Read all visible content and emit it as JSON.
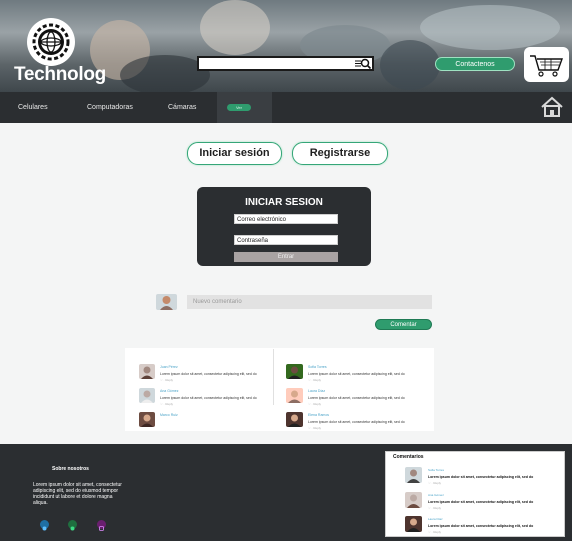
{
  "brand": {
    "name": "Technolog"
  },
  "header": {
    "search": {
      "value": "",
      "placeholder": ""
    },
    "contact_label": "Contactenos"
  },
  "nav": {
    "items": [
      "Celulares",
      "Computadoras",
      "Cámaras"
    ],
    "active_pill": "Ver"
  },
  "auth": {
    "login_label": "Iniciar sesión",
    "register_label": "Registrarse"
  },
  "login_card": {
    "title": "INICIAR SESION",
    "email_placeholder": "Correo electrónico",
    "password_placeholder": "Contraseña",
    "submit_label": "Entrar"
  },
  "composer": {
    "placeholder": "Nuevo comentario",
    "submit_label": "Comentar"
  },
  "comments": [
    {
      "name": "Juan Pérez",
      "text": "Lorem ipsum dolor sit amet, consectetur adipiscing elit, sed do",
      "meta": "♡  ·  Reply"
    },
    {
      "name": "Ana Gómez",
      "text": "Lorem ipsum dolor sit amet, consectetur adipiscing elit, sed do",
      "meta": "♡  ·  Reply"
    },
    {
      "name": "Marco Ruiz",
      "text": "Lorem ipsum dolor sit amet, consectetur adipiscing elit, sed do",
      "meta": "♡  ·  Reply"
    },
    {
      "name": "Sofia Torres",
      "text": "Lorem ipsum dolor sit amet, consectetur adipiscing elit, sed do",
      "meta": "♡  ·  Reply"
    },
    {
      "name": "Laura Díaz",
      "text": "Lorem ipsum dolor sit amet, consectetur adipiscing elit, sed do",
      "meta": "♡  ·  Reply"
    },
    {
      "name": "Elena Ramos",
      "text": "Lorem ipsum dolor sit amet, consectetur adipiscing elit, sed do",
      "meta": "♡  ·  Reply"
    }
  ],
  "footer": {
    "about_title": "Sobre nosotros",
    "about_text": "Lorem ipsum dolor sit amet, consectetur adipiscing elit, sed do eiusmod tempor incididunt ut labore et dolore magna aliqua.",
    "comments_title": "Comentarios",
    "comments": [
      {
        "name": "Sofia Torres",
        "text": "Lorem ipsum dolor sit amet, consectetur adipiscing elit, sed do",
        "meta": "♡  ·  Reply"
      },
      {
        "name": "Ana Gómez",
        "text": "Lorem ipsum dolor sit amet, consectetur adipiscing elit, sed do",
        "meta": "♡  ·  Reply"
      },
      {
        "name": "Laura Díaz",
        "text": "Lorem ipsum dolor sit amet, consectetur adipiscing elit, sed do",
        "meta": "♡  ·  Reply"
      }
    ]
  },
  "icons": [
    "gear-logo-icon",
    "search-icon",
    "cart-icon",
    "home-icon",
    "twitter-icon",
    "spotify-icon",
    "instagram-icon"
  ],
  "colors": {
    "accent": "#2f9c6e",
    "dark": "#2b2e31",
    "link": "#4aa3c8"
  }
}
